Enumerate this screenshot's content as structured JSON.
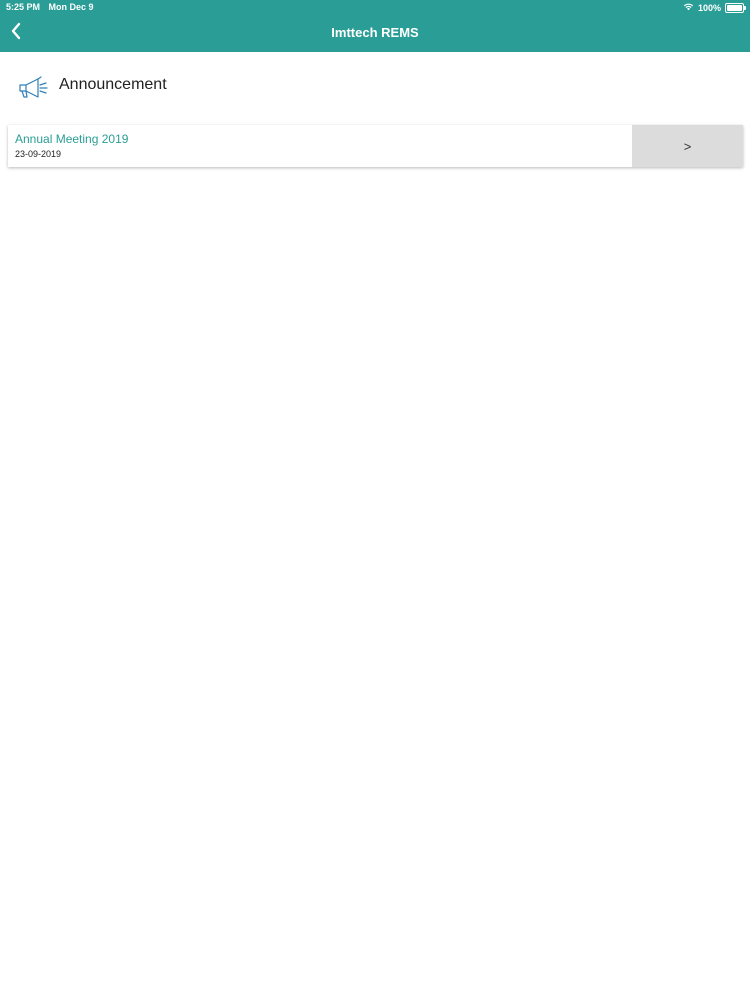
{
  "status_bar": {
    "time": "5:25 PM",
    "date": "Mon Dec 9",
    "battery": "100%",
    "icons": [
      "wifi-icon",
      "battery-icon"
    ]
  },
  "nav": {
    "title": "Imttech REMS",
    "back_icon": "chevron-left-icon"
  },
  "section": {
    "title": "Announcement",
    "icon": "megaphone-icon"
  },
  "announcements": [
    {
      "title": "Annual Meeting 2019",
      "date": "23-09-2019",
      "action_label": ">"
    }
  ],
  "colors": {
    "brand": "#2a9d96",
    "chevron_bg": "#dcdcdc",
    "text": "#222222"
  }
}
